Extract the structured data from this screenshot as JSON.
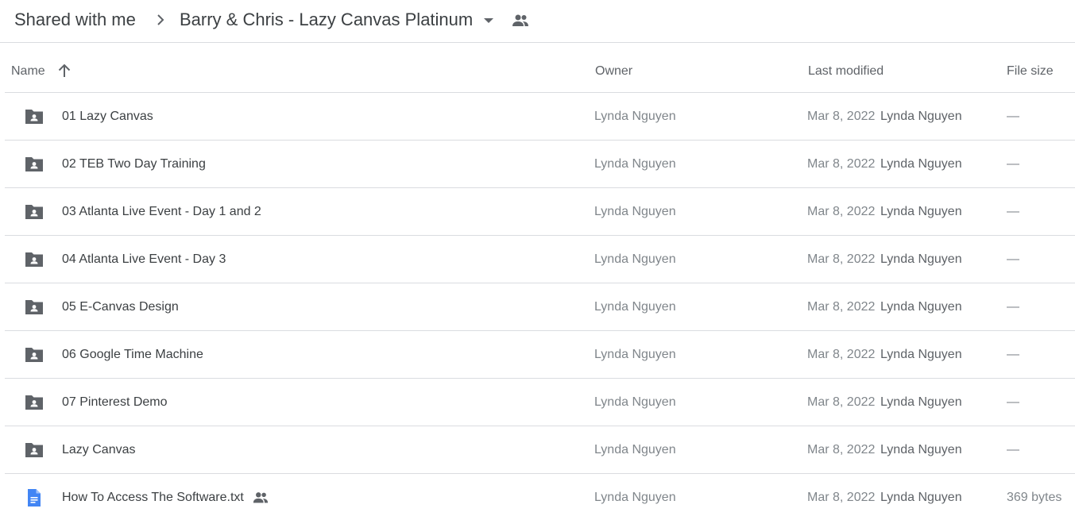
{
  "breadcrumb": {
    "parent": "Shared with me",
    "current": "Barry & Chris - Lazy Canvas Platinum",
    "separator_icon": "chevron-right-icon",
    "dropdown_icon": "caret-down-icon",
    "shared_icon": "people-icon"
  },
  "table": {
    "columns": {
      "name": "Name",
      "owner": "Owner",
      "last_modified": "Last modified",
      "file_size": "File size"
    },
    "sort": {
      "column": "name",
      "direction": "ascending",
      "icon": "arrow-up-icon"
    },
    "rows": [
      {
        "name": "01 Lazy Canvas",
        "type": "shared-folder",
        "owner": "Lynda Nguyen",
        "modified_date": "Mar 8, 2022",
        "modified_by": "Lynda Nguyen",
        "size": "—"
      },
      {
        "name": "02 TEB Two Day Training",
        "type": "shared-folder",
        "owner": "Lynda Nguyen",
        "modified_date": "Mar 8, 2022",
        "modified_by": "Lynda Nguyen",
        "size": "—"
      },
      {
        "name": "03 Atlanta Live Event - Day 1 and 2",
        "type": "shared-folder",
        "owner": "Lynda Nguyen",
        "modified_date": "Mar 8, 2022",
        "modified_by": "Lynda Nguyen",
        "size": "—"
      },
      {
        "name": "04 Atlanta Live Event - Day 3",
        "type": "shared-folder",
        "owner": "Lynda Nguyen",
        "modified_date": "Mar 8, 2022",
        "modified_by": "Lynda Nguyen",
        "size": "—"
      },
      {
        "name": "05 E-Canvas Design",
        "type": "shared-folder",
        "owner": "Lynda Nguyen",
        "modified_date": "Mar 8, 2022",
        "modified_by": "Lynda Nguyen",
        "size": "—"
      },
      {
        "name": "06 Google Time Machine",
        "type": "shared-folder",
        "owner": "Lynda Nguyen",
        "modified_date": "Mar 8, 2022",
        "modified_by": "Lynda Nguyen",
        "size": "—"
      },
      {
        "name": "07 Pinterest Demo",
        "type": "shared-folder",
        "owner": "Lynda Nguyen",
        "modified_date": "Mar 8, 2022",
        "modified_by": "Lynda Nguyen",
        "size": "—"
      },
      {
        "name": "Lazy Canvas",
        "type": "shared-folder",
        "owner": "Lynda Nguyen",
        "modified_date": "Mar 8, 2022",
        "modified_by": "Lynda Nguyen",
        "size": "—"
      },
      {
        "name": "How To Access The Software.txt",
        "type": "document",
        "shared": true,
        "owner": "Lynda Nguyen",
        "modified_date": "Mar 8, 2022",
        "modified_by": "Lynda Nguyen",
        "size": "369 bytes"
      }
    ]
  },
  "colors": {
    "folder_icon": "#5f6368",
    "doc_icon": "#4285f4",
    "divider": "#dadce0",
    "text_primary": "#3c4043",
    "text_secondary": "#80868b"
  }
}
